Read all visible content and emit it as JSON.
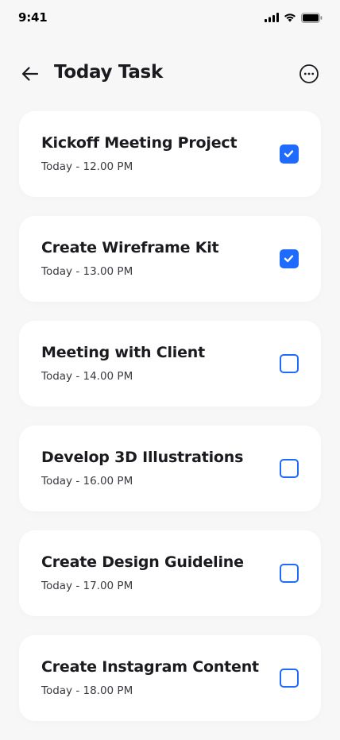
{
  "status_bar": {
    "time": "9:41",
    "icons": [
      "signal-icon",
      "wifi-icon",
      "battery-icon"
    ]
  },
  "header": {
    "title": "Today Task",
    "back_icon": "arrow-left-icon",
    "more_icon": "more-horizontal-icon"
  },
  "colors": {
    "accent": "#1F6BFF",
    "background": "#F7F7F8",
    "card": "#FFFFFF",
    "text": "#1B1B1F"
  },
  "tasks": [
    {
      "title": "Kickoff Meeting Project",
      "time": "Today - 12.00 PM",
      "done": true
    },
    {
      "title": "Create Wireframe Kit",
      "time": "Today - 13.00 PM",
      "done": true
    },
    {
      "title": "Meeting with Client",
      "time": "Today - 14.00 PM",
      "done": false
    },
    {
      "title": "Develop 3D Illustrations",
      "time": "Today - 16.00 PM",
      "done": false
    },
    {
      "title": "Create Design Guideline",
      "time": "Today - 17.00 PM",
      "done": false
    },
    {
      "title": "Create Instagram Content",
      "time": "Today - 18.00 PM",
      "done": false
    }
  ]
}
